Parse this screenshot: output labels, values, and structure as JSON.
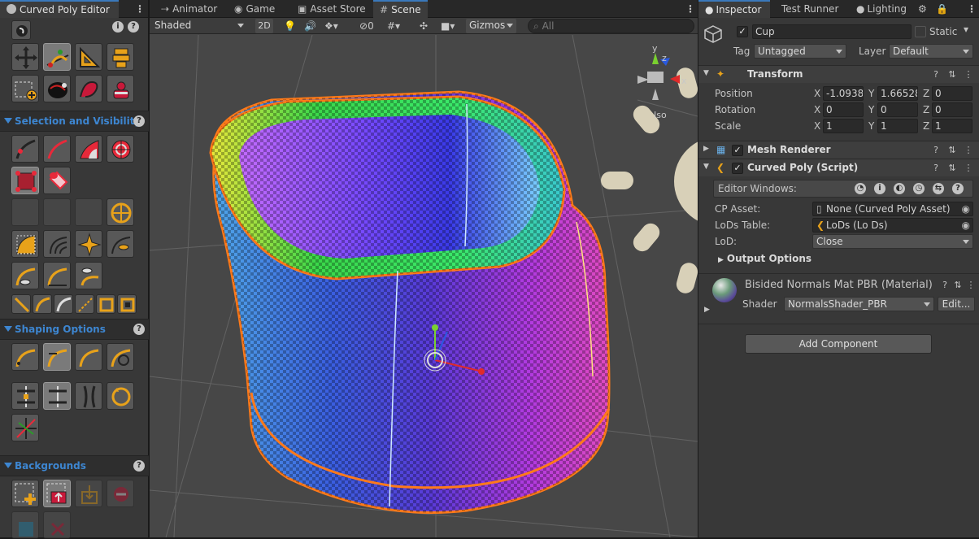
{
  "left_panel": {
    "tab_title": "Curved Poly Editor",
    "sections": {
      "selection": "Selection and Visibility",
      "shaping": "Shaping Options",
      "backgrounds": "Backgrounds"
    }
  },
  "scene_tabs": [
    "Animator",
    "Game",
    "Asset Store",
    "Scene"
  ],
  "scene_toolbar": {
    "shading": "Shaded",
    "mode_2d": "2D",
    "hidden_count": "0",
    "gizmos": "Gizmos",
    "search_placeholder": "All"
  },
  "gizmo_axes": {
    "x": "x",
    "y": "y",
    "z": "z",
    "iso": "Iso"
  },
  "inspector": {
    "tabs": [
      "Inspector",
      "Test Runner",
      "Lighting"
    ],
    "object_name": "Cup",
    "static_label": "Static",
    "tag_label": "Tag",
    "tag_value": "Untagged",
    "layer_label": "Layer",
    "layer_value": "Default",
    "transform": {
      "title": "Transform",
      "position_label": "Position",
      "rotation_label": "Rotation",
      "scale_label": "Scale",
      "position": {
        "x": "-1.0938",
        "y": "1.66528",
        "z": "0"
      },
      "rotation": {
        "x": "0",
        "y": "0",
        "z": "0"
      },
      "scale": {
        "x": "1",
        "y": "1",
        "z": "1"
      }
    },
    "mesh_renderer": "Mesh Renderer",
    "curved_poly": {
      "title": "Curved Poly (Script)",
      "editor_windows": "Editor Windows:",
      "cp_asset_label": "CP Asset:",
      "cp_asset_value": "None (Curved Poly Asset)",
      "lods_table_label": "LoDs Table:",
      "lods_table_value": "LoDs (Lo Ds)",
      "lod_label": "LoD:",
      "lod_value": "Close",
      "output_options": "Output Options"
    },
    "material": {
      "title": "Bisided Normals Mat PBR (Material)",
      "shader_label": "Shader",
      "shader_value": "NormalsShader_PBR",
      "edit_button": "Edit..."
    },
    "add_component": "Add Component"
  },
  "colors": {
    "accent": "#3d86d1",
    "selection_outline": "#ff7a1a"
  }
}
